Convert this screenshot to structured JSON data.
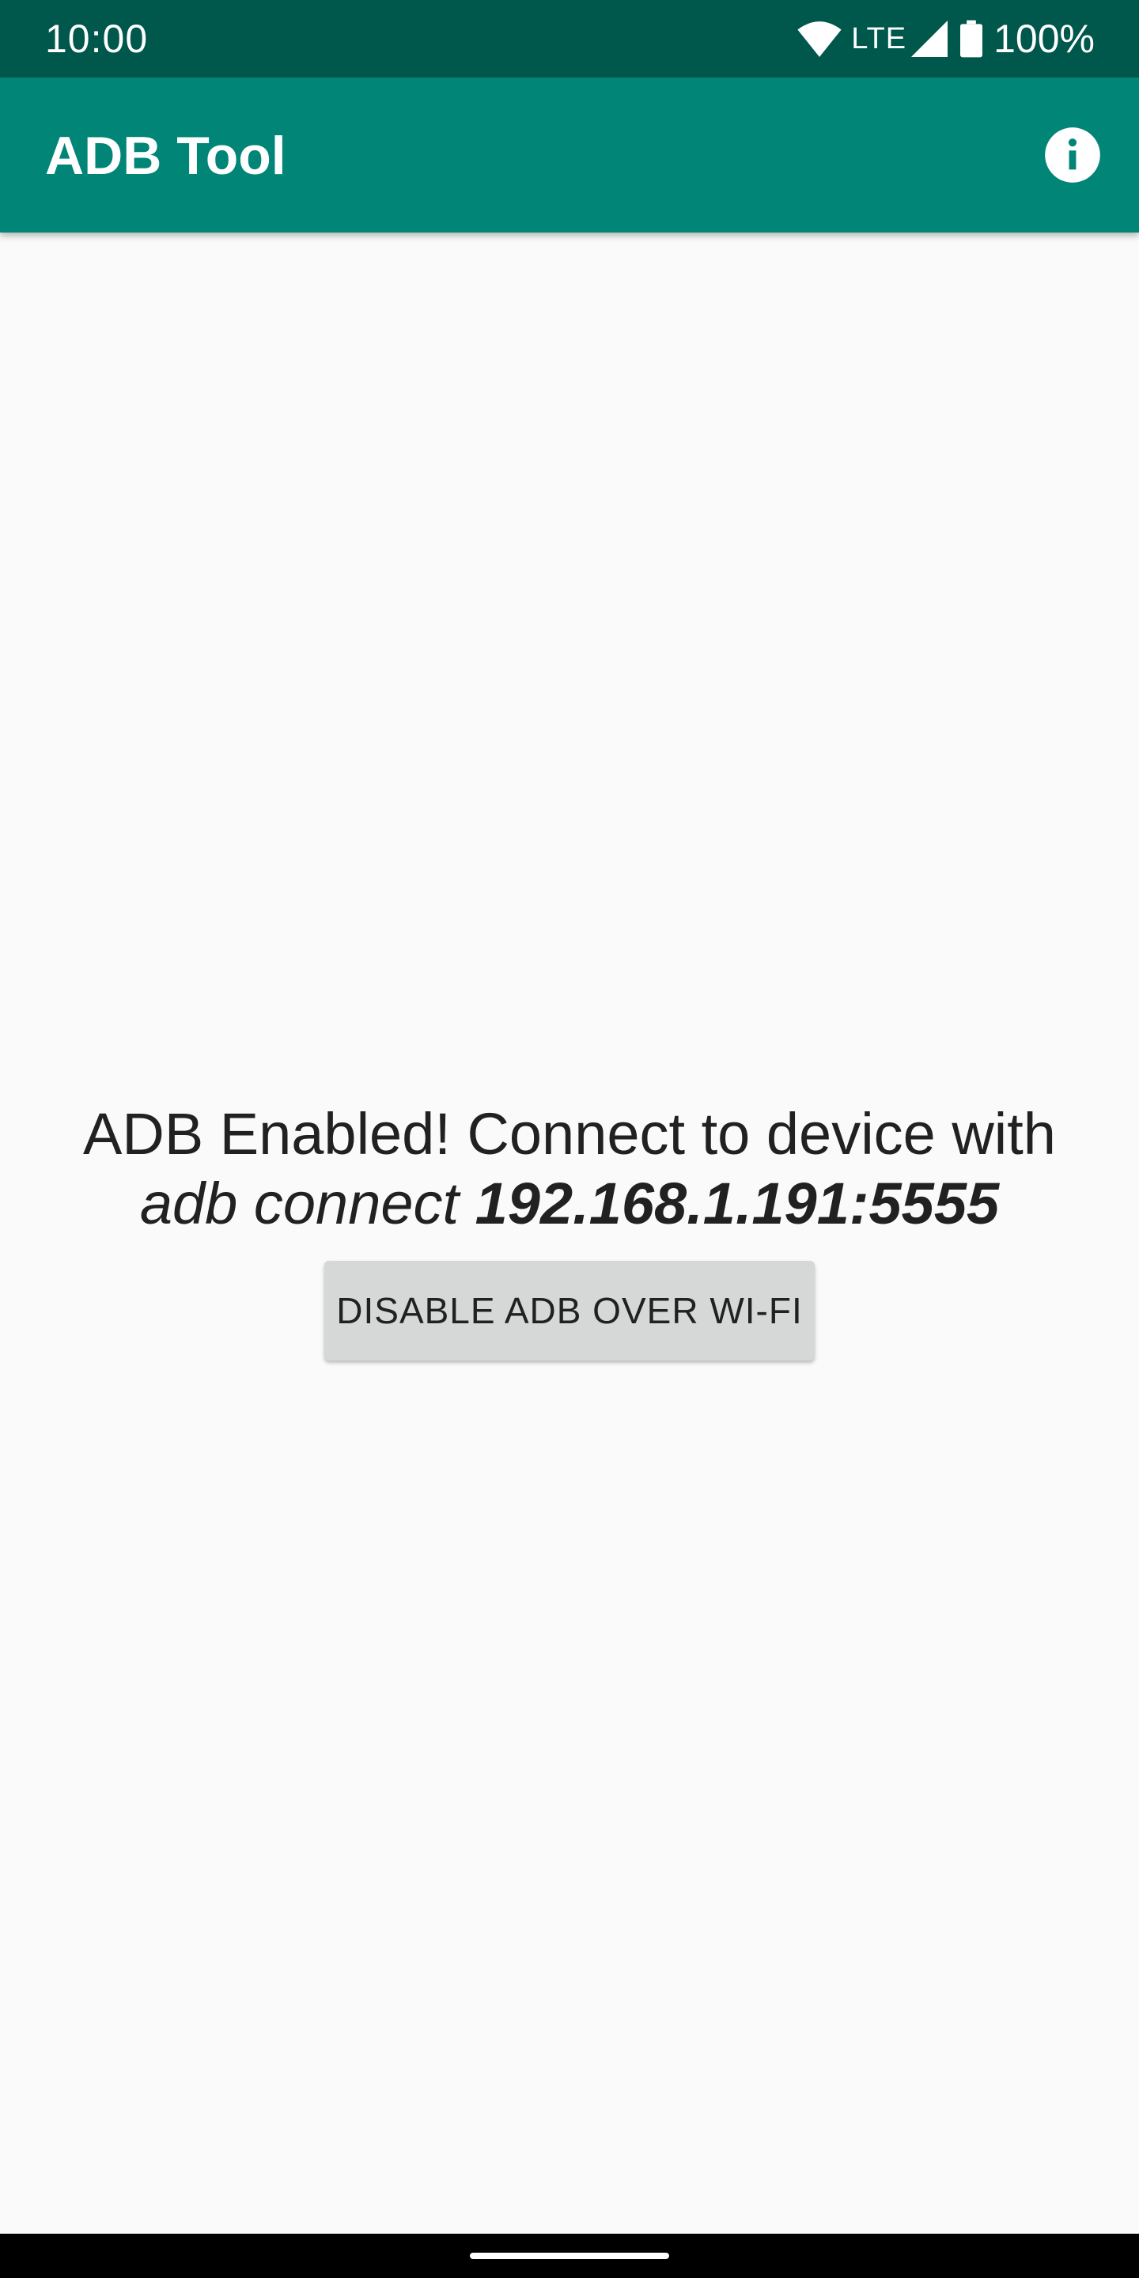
{
  "status_bar": {
    "time": "10:00",
    "network": "LTE",
    "battery": "100%",
    "icons": [
      "wifi-icon",
      "cell-signal-icon",
      "battery-icon"
    ]
  },
  "app_bar": {
    "title": "ADB Tool",
    "info_icon": "info-icon"
  },
  "main": {
    "message_prefix": "ADB Enabled! Connect to device with",
    "command": "adb connect",
    "address": "192.168.1.191:5555",
    "disable_button_label": "DISABLE ADB OVER WI-FI"
  },
  "colors": {
    "status_bar": "#00574b",
    "app_bar": "#008577",
    "background": "#fafafa",
    "button": "#d6d7d7",
    "text": "#212121"
  }
}
